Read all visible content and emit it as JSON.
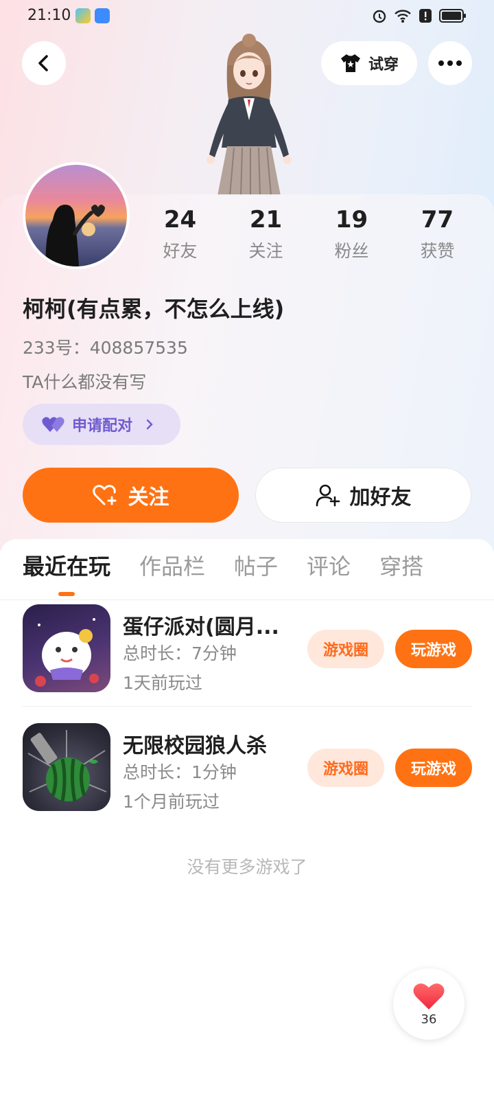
{
  "status_bar": {
    "time": "21:10"
  },
  "header": {
    "back_icon": "chevron-left-icon",
    "tryon_label": "试穿",
    "tryon_icon": "tshirt-icon",
    "more_icon": "more-dots-icon"
  },
  "profile": {
    "stats": [
      {
        "value": "24",
        "label": "好友"
      },
      {
        "value": "21",
        "label": "关注"
      },
      {
        "value": "19",
        "label": "粉丝"
      },
      {
        "value": "77",
        "label": "获赞"
      }
    ],
    "name": "柯柯(有点累，不怎么上线)",
    "uid": "233号：408857535",
    "bio": "TA什么都没有写",
    "pair_label": "申请配对",
    "follow_label": "关注",
    "add_friend_label": "加好友"
  },
  "tabs": [
    {
      "label": "最近在玩",
      "active": true
    },
    {
      "label": "作品栏",
      "active": false
    },
    {
      "label": "帖子",
      "active": false
    },
    {
      "label": "评论",
      "active": false
    },
    {
      "label": "穿搭",
      "active": false
    }
  ],
  "games": [
    {
      "title": "蛋仔派对(圆月...",
      "duration": "总时长：7分钟",
      "last_played": "1天前玩过",
      "circle_label": "游戏圈",
      "play_label": "玩游戏"
    },
    {
      "title": "无限校园狼人杀",
      "duration": "总时长：1分钟",
      "last_played": "1个月前玩过",
      "circle_label": "游戏圈",
      "play_label": "玩游戏"
    }
  ],
  "no_more_text": "没有更多游戏了",
  "like_fab": {
    "count": "36",
    "icon": "heart-icon"
  },
  "colors": {
    "accent": "#ff7213",
    "pair": "#6f5bd0"
  }
}
